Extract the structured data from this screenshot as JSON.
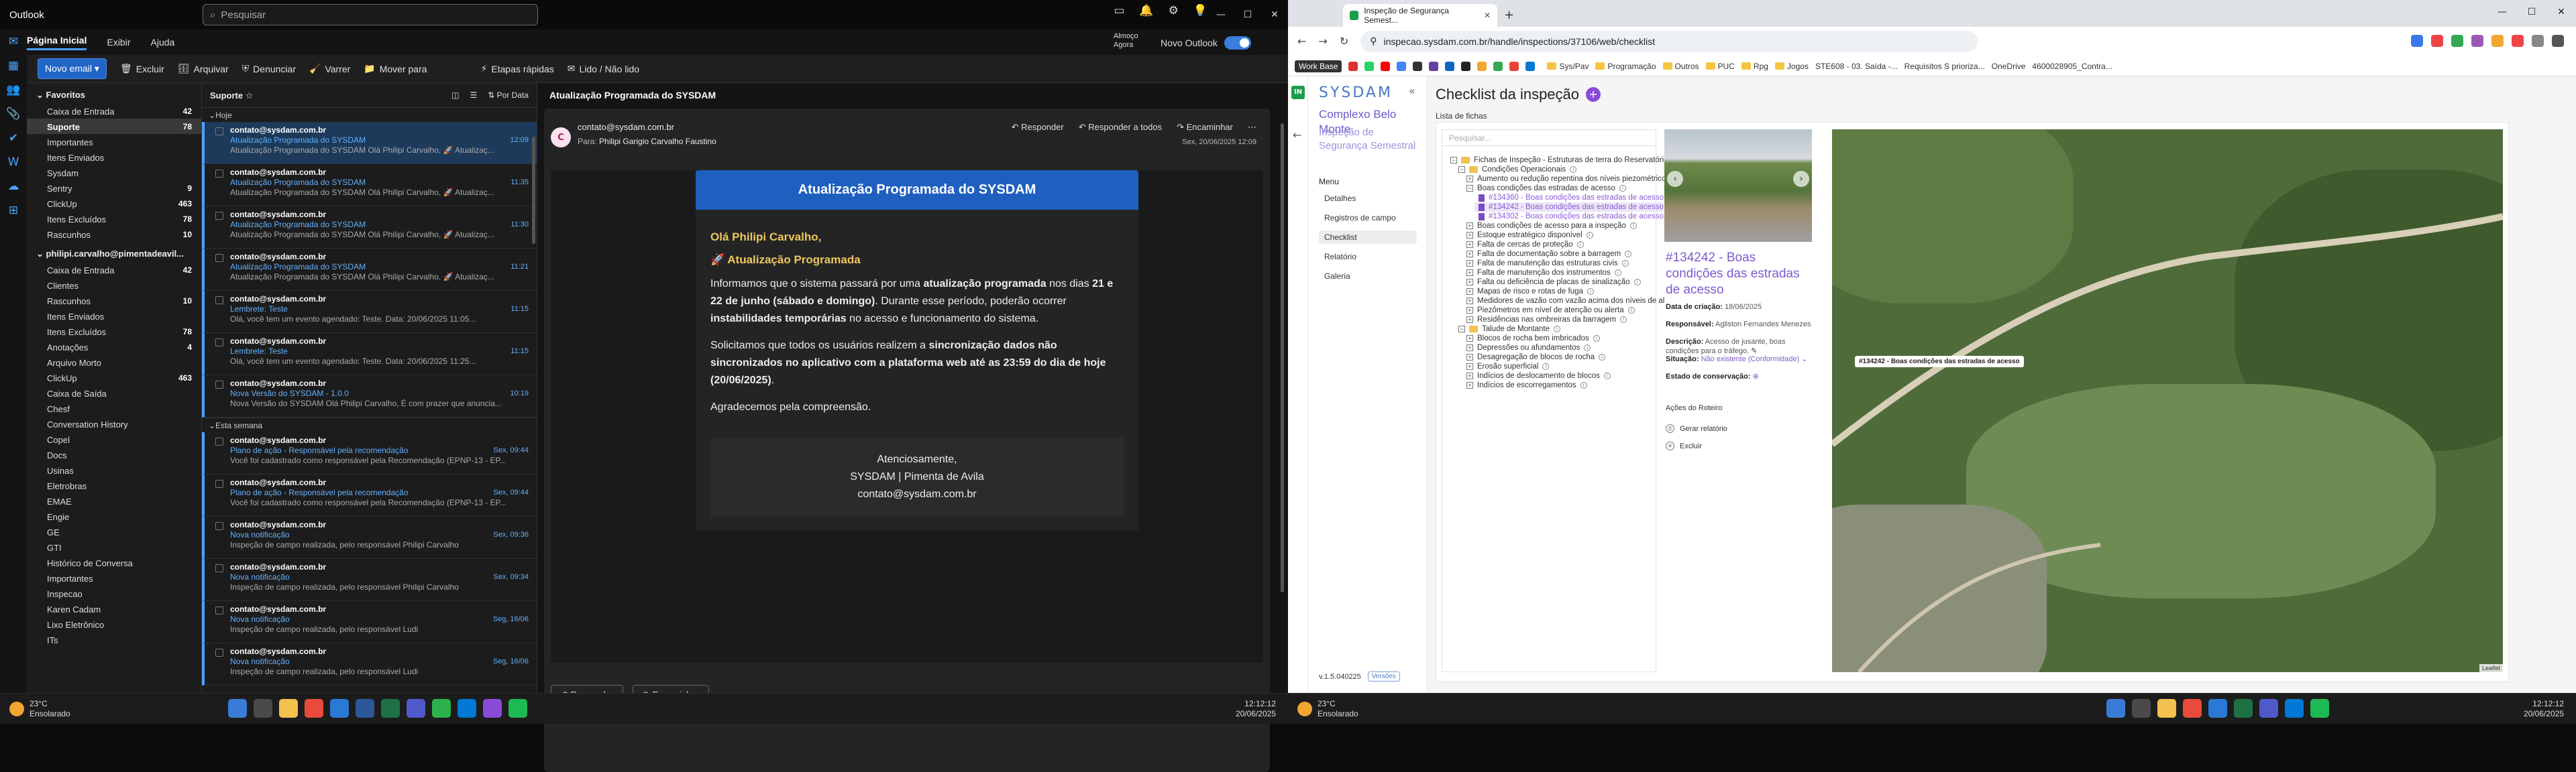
{
  "outlook": {
    "app_title": "Outlook",
    "search_placeholder": "Pesquisar",
    "tabs": [
      "Página Inicial",
      "Exibir",
      "Ajuda"
    ],
    "status_line1": "Almoço",
    "status_line2": "Agora",
    "new_outlook_label": "Novo Outlook",
    "ribbon": {
      "new_mail": "Novo email",
      "delete": "Excluir",
      "archive": "Arquivar",
      "report": "Denunciar",
      "sweep": "Varrer",
      "move_to": "Mover para",
      "quick_steps": "Etapas rápidas",
      "read_unread": "Lido / Não lido"
    },
    "folders_group1": "Favoritos",
    "folders1": [
      {
        "label": "Caixa de Entrada",
        "count": "42"
      },
      {
        "label": "Suporte",
        "count": "78",
        "selected": true
      },
      {
        "label": "Importantes",
        "count": ""
      },
      {
        "label": "Itens Enviados",
        "count": ""
      },
      {
        "label": "Sysdam",
        "count": ""
      },
      {
        "label": "Sentry",
        "count": "9"
      },
      {
        "label": "ClickUp",
        "count": "463"
      },
      {
        "label": "Itens Excluídos",
        "count": "78"
      },
      {
        "label": "Rascunhos",
        "count": "10"
      }
    ],
    "folders_group2": "philipi.carvalho@pimentadeavil...",
    "folders2": [
      {
        "label": "Caixa de Entrada",
        "count": "42"
      },
      {
        "label": "Clientes",
        "count": ""
      },
      {
        "label": "Rascunhos",
        "count": "10"
      },
      {
        "label": "Itens Enviados",
        "count": ""
      },
      {
        "label": "Itens Excluídos",
        "count": "78"
      },
      {
        "label": "Anotações",
        "count": "4"
      },
      {
        "label": "Arquivo Morto",
        "count": ""
      },
      {
        "label": "ClickUp",
        "count": "463"
      },
      {
        "label": "Caixa de Saída",
        "count": ""
      },
      {
        "label": "Chesf",
        "count": ""
      },
      {
        "label": "Conversation History",
        "count": ""
      },
      {
        "label": "Copel",
        "count": ""
      },
      {
        "label": "Docs",
        "count": ""
      },
      {
        "label": "Usinas",
        "count": ""
      },
      {
        "label": "Eletrobras",
        "count": ""
      },
      {
        "label": "EMAE",
        "count": ""
      },
      {
        "label": "Engie",
        "count": ""
      },
      {
        "label": "GE",
        "count": ""
      },
      {
        "label": "GTI",
        "count": ""
      },
      {
        "label": "Histórico de Conversa",
        "count": ""
      },
      {
        "label": "Importantes",
        "count": ""
      },
      {
        "label": "Inspecao",
        "count": ""
      },
      {
        "label": "Karen Cadam",
        "count": ""
      },
      {
        "label": "Lixo Eletrônico",
        "count": ""
      },
      {
        "label": "ITs",
        "count": ""
      }
    ],
    "list_title": "Suporte",
    "list_filter": "Por Data",
    "section_today": "Hoje",
    "section_week": "Esta semana",
    "messages_today": [
      {
        "from": "contato@sysdam.com.br",
        "subject": "Atualização Programada do SYSDAM",
        "preview": "Atualização Programada do SYSDAM Olá Philipi Carvalho, 🚀 Atualizaç...",
        "time": "12:09",
        "selected": true
      },
      {
        "from": "contato@sysdam.com.br",
        "subject": "Atualização Programada do SYSDAM",
        "preview": "Atualização Programada do SYSDAM Olá Philipi Carvalho, 🚀 Atualizaç...",
        "time": "11:35"
      },
      {
        "from": "contato@sysdam.com.br",
        "subject": "Atualização Programada do SYSDAM",
        "preview": "Atualização Programada do SYSDAM Olá Philipi Carvalho, 🚀 Atualizaç...",
        "time": "11:30"
      },
      {
        "from": "contato@sysdam.com.br",
        "subject": "Atualização Programada do SYSDAM",
        "preview": "Atualização Programada do SYSDAM Olá Philipi Carvalho, 🚀 Atualizaç...",
        "time": "11:21"
      },
      {
        "from": "contato@sysdam.com.br",
        "subject": "Lembrete: Teste",
        "preview": "Olá, você tem um evento agendado: Teste. Data: 20/06/2025 11:05...",
        "time": "11:15"
      },
      {
        "from": "contato@sysdam.com.br",
        "subject": "Lembrete: Teste",
        "preview": "Olá, você tem um evento agendado: Teste. Data: 20/06/2025 11:25...",
        "time": "11:15"
      },
      {
        "from": "contato@sysdam.com.br",
        "subject": "Nova Versão do SYSDAM - 1.0.0",
        "preview": "Nova Versão do SYSDAM Olá Philipi Carvalho, É com prazer que anuncia...",
        "time": "10:19"
      }
    ],
    "messages_week": [
      {
        "from": "contato@sysdam.com.br",
        "subject": "Plano de ação - Responsável pela recomendação",
        "preview": "Você foi cadastrado como responsável pela Recomendação (EPNP-13 - EP...",
        "time": "Sex, 09:44"
      },
      {
        "from": "contato@sysdam.com.br",
        "subject": "Plano de ação - Responsável pela recomendação",
        "preview": "Você foi cadastrado como responsável pela Recomendação (EPNP-13 - EP...",
        "time": "Sex, 09:44"
      },
      {
        "from": "contato@sysdam.com.br",
        "subject": "Nova notificação",
        "preview": "Inspeção de campo realizada, pelo responsável Philipi Carvalho",
        "time": "Sex, 09:36"
      },
      {
        "from": "contato@sysdam.com.br",
        "subject": "Nova notificação",
        "preview": "Inspeção de campo realizada, pelo responsável Philipi Carvalho",
        "time": "Sex, 09:34"
      },
      {
        "from": "contato@sysdam.com.br",
        "subject": "Nova notificação",
        "preview": "Inspeção de campo realizada, pelo responsável Ludi",
        "time": "Seg, 16/06"
      },
      {
        "from": "contato@sysdam.com.br",
        "subject": "Nova notificação",
        "preview": "Inspeção de campo realizada, pelo responsável Ludi",
        "time": "Seg, 16/06"
      }
    ],
    "reading": {
      "subject": "Atualização Programada do SYSDAM",
      "avatar": "C",
      "from": "contato@sysdam.com.br",
      "to_label": "Para:",
      "to": "Philipi Garigio Carvalho Faustino",
      "reply": "Responder",
      "reply_all": "Responder a todos",
      "forward": "Encaminhar",
      "date": "Sex, 20/06/2025 12:09",
      "email_title": "Atualização Programada do SYSDAM",
      "greeting": "Olá Philipi Carvalho,",
      "update_heading": "🚀 Atualização Programada",
      "p1_a": "Informamos que o sistema passará por uma ",
      "p1_b": "atualização programada",
      "p1_c": " nos dias ",
      "p1_d": "21 e 22 de junho (sábado e domingo)",
      "p1_e": ". Durante esse período, poderão ocorrer ",
      "p1_f": "instabilidades temporárias",
      "p1_g": " no acesso e funcionamento do sistema.",
      "p2_a": "Solicitamos que todos os usuários realizem a ",
      "p2_b": "sincronização dados não sincronizados no aplicativo com a plataforma web até as 23:59 do dia de hoje (20/06/2025)",
      "p2_c": ".",
      "p3": "Agradecemos pela compreensão.",
      "sign1": "Atenciosamente,",
      "sign2": "SYSDAM | Pimenta de Avila",
      "sign3": "contato@sysdam.com.br",
      "bottom_reply": "Responder",
      "bottom_forward": "Encaminhar"
    }
  },
  "taskbar": {
    "temp": "23°C",
    "weather": "Ensolarado",
    "time": "12:12:12",
    "date": "20/06/2025"
  },
  "chrome": {
    "tab_title": "Inspeção de Segurança Semest...",
    "url": "inspecao.sysdam.com.br/handle/inspections/37106/web/checklist",
    "bookmarks": [
      "Work Base",
      "Sys/Pav",
      "Programação",
      "Outros",
      "PUC",
      "Rpg",
      "Jogos",
      "STE608 - 03. Saída -...",
      "Requisitos S prioriza...",
      "OneDrive",
      "4600028905_Contra..."
    ],
    "app": {
      "logo": "SYSDAM",
      "project": "Complexo Belo Monte",
      "inspection": "Inspeção de Segurança Semestral",
      "menu_title": "Menu",
      "menu": [
        "Detalhes",
        "Registros de campo",
        "Checklist",
        "Relatório",
        "Galeria"
      ],
      "version": "v.1.5.040225",
      "versions_button": "Versões",
      "page_title": "Checklist da inspeção",
      "list_label": "Lista de fichas",
      "search_placeholder": "Pesquisar...",
      "tree": [
        {
          "label": "Fichas de Inspeção - Estruturas de terra do Reservatório Intermediário",
          "level": 0,
          "kind": "folder",
          "exp": "−"
        },
        {
          "label": "Condições Operacionais",
          "level": 1,
          "kind": "folder",
          "exp": "−"
        },
        {
          "label": "Aumento ou redução repentina dos níveis piezométricos",
          "level": 2,
          "kind": "item",
          "exp": "+"
        },
        {
          "label": "Boas condições das estradas de acesso",
          "level": 2,
          "kind": "item",
          "exp": "−"
        },
        {
          "label": "#134360 - Boas condições das estradas de acesso",
          "level": 3,
          "kind": "doc"
        },
        {
          "label": "#134242 - Boas condições das estradas de acesso",
          "level": 3,
          "kind": "doc",
          "selected": true
        },
        {
          "label": "#134302 - Boas condições das estradas de acesso",
          "level": 3,
          "kind": "doc"
        },
        {
          "label": "Boas condições de acesso para a inspeção",
          "level": 2,
          "kind": "item",
          "exp": "+"
        },
        {
          "label": "Estoque estratégico disponível",
          "level": 2,
          "kind": "item",
          "exp": "+"
        },
        {
          "label": "Falta de cercas de proteção",
          "level": 2,
          "kind": "item",
          "exp": "+"
        },
        {
          "label": "Falta de documentação sobre a barragem",
          "level": 2,
          "kind": "item",
          "exp": "+"
        },
        {
          "label": "Falta de manutenção das estruturas civis",
          "level": 2,
          "kind": "item",
          "exp": "+"
        },
        {
          "label": "Falta de manutenção dos instrumentos",
          "level": 2,
          "kind": "item",
          "exp": "+"
        },
        {
          "label": "Falta ou deficiência de placas de sinalização",
          "level": 2,
          "kind": "item",
          "exp": "+"
        },
        {
          "label": "Mapas de risco e rotas de fuga",
          "level": 2,
          "kind": "item",
          "exp": "+"
        },
        {
          "label": "Medidores de vazão com vazão acima dos níveis de alerta ou atenção",
          "level": 2,
          "kind": "item",
          "exp": "+"
        },
        {
          "label": "Piezômetros em nível de atenção ou alerta",
          "level": 2,
          "kind": "item",
          "exp": "+"
        },
        {
          "label": "Residências nas ombreiras da barragem",
          "level": 2,
          "kind": "item",
          "exp": "+"
        },
        {
          "label": "Talude de Montante",
          "level": 1,
          "kind": "folder",
          "exp": "−"
        },
        {
          "label": "Blocos de rocha bem imbricados",
          "level": 2,
          "kind": "item",
          "exp": "+"
        },
        {
          "label": "Depressões ou afundamentos",
          "level": 2,
          "kind": "item",
          "exp": "+"
        },
        {
          "label": "Desagregação de blocos de rocha",
          "level": 2,
          "kind": "item",
          "exp": "+"
        },
        {
          "label": "Erosão superficial",
          "level": 2,
          "kind": "item",
          "exp": "+"
        },
        {
          "label": "Indícios de deslocamento de blocos",
          "level": 2,
          "kind": "item",
          "exp": "+"
        },
        {
          "label": "Indícios de escorregamentos",
          "level": 2,
          "kind": "item",
          "exp": "+"
        }
      ],
      "detail": {
        "title": "#134242 - Boas condições das estradas de acesso",
        "created_label": "Data de criação:",
        "created": "18/06/2025",
        "resp_label": "Responsável:",
        "resp": "Agliston Fernandes Menezes",
        "desc_label": "Descrição:",
        "desc": "Acesso de jusante, boas condições para o tráfego.",
        "status_label": "Situação:",
        "status": "Não existente (Conformidade)",
        "state_label": "Estado de conservação:",
        "actions_title": "Ações do Roteiro",
        "report_action": "Gerar relatório",
        "delete_action": "Excluir"
      },
      "map_tooltip": "#134242 - Boas condições das estradas de acesso",
      "map_attribution": "Leaflet"
    }
  }
}
